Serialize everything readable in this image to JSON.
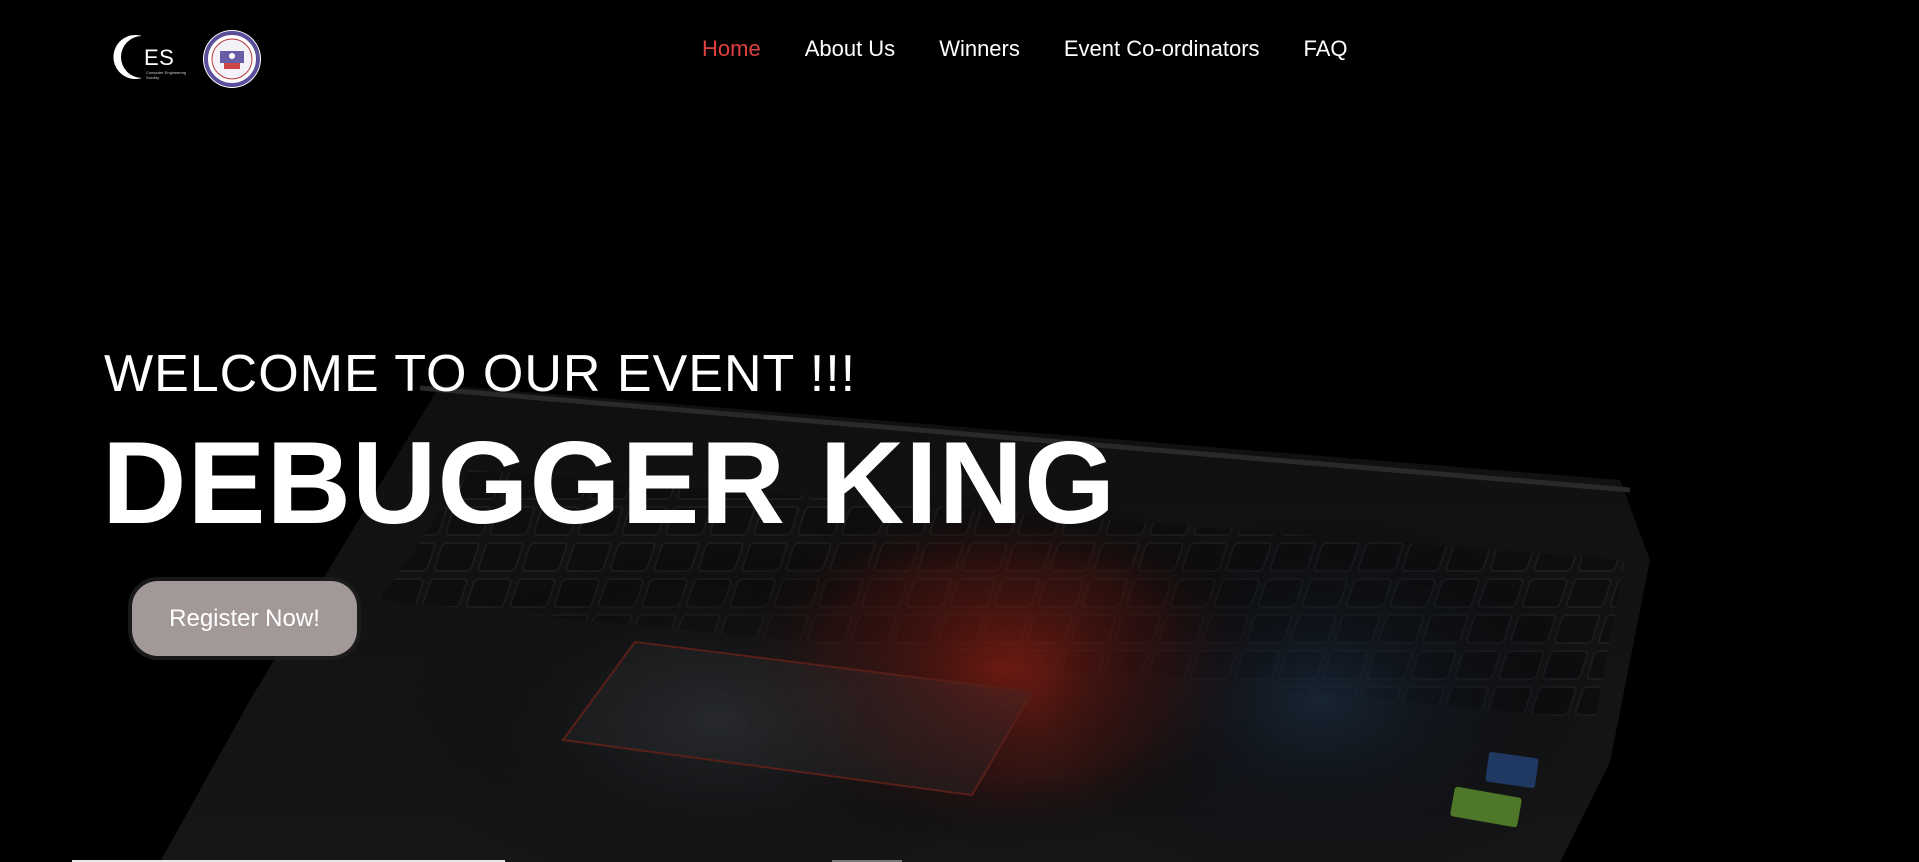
{
  "header": {
    "logo": {
      "text": "ES",
      "subtitle": "Computer Engineering Society"
    },
    "nav": [
      {
        "label": "Home",
        "active": true
      },
      {
        "label": "About Us",
        "active": false
      },
      {
        "label": "Winners",
        "active": false
      },
      {
        "label": "Event Co-ordinators",
        "active": false
      },
      {
        "label": "FAQ",
        "active": false
      }
    ]
  },
  "hero": {
    "welcome": "WELCOME TO OUR EVENT !!!",
    "title": "DEBUGGER KING",
    "cta_label": "Register Now!"
  },
  "colors": {
    "background": "#000000",
    "nav_active": "#e0403e",
    "nav_text": "#ffffff",
    "cta_background": "#a39898"
  },
  "icons": {
    "brand_logo": "ces-logo",
    "college_emblem": "college-emblem-icon"
  }
}
